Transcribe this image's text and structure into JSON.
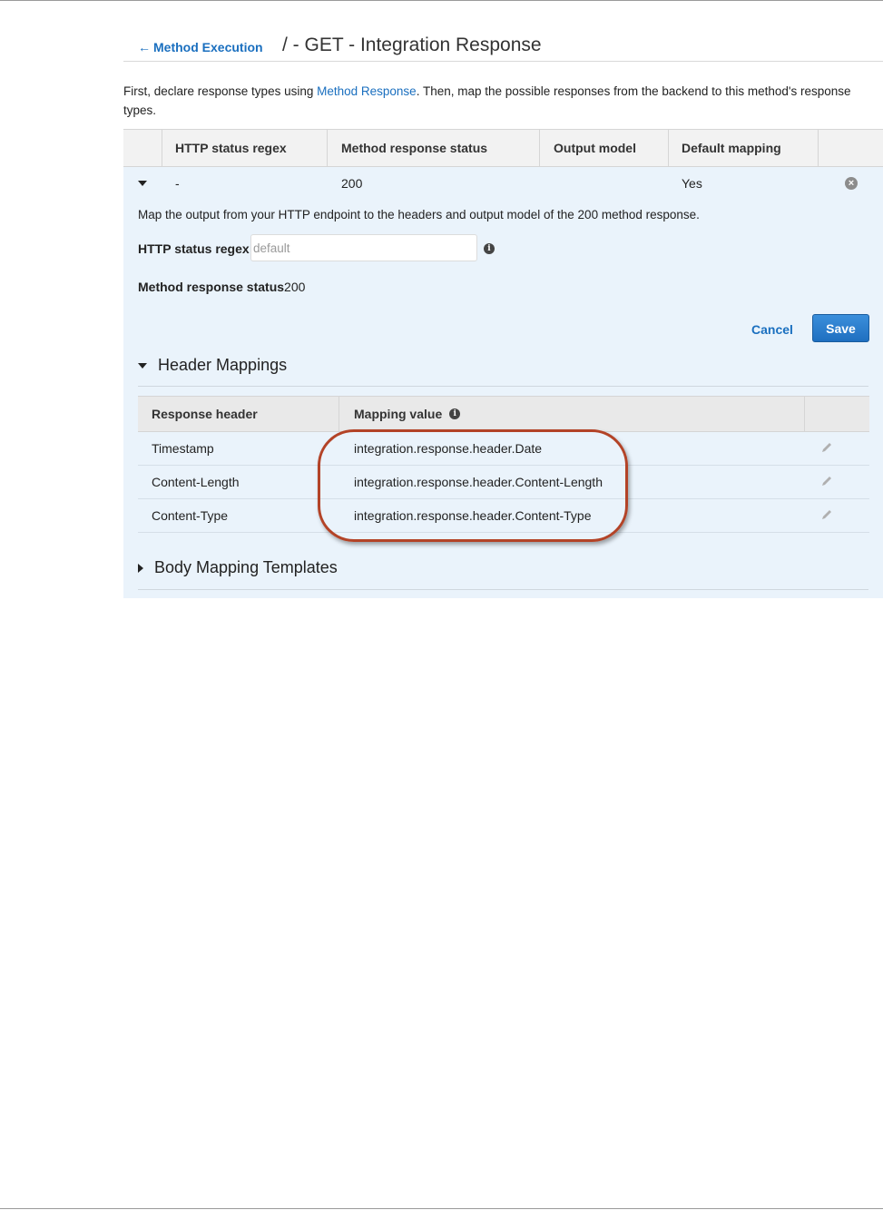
{
  "header": {
    "back_label": "Method Execution",
    "title": "/ - GET - Integration Response"
  },
  "intro": {
    "text_before": "First, declare response types using ",
    "link": "Method Response",
    "text_after": ". Then, map the possible responses from the backend to this method's response types."
  },
  "response_table": {
    "columns": [
      "HTTP status regex",
      "Method response status",
      "Output model",
      "Default mapping"
    ],
    "row": {
      "regex": "-",
      "status": "200",
      "output_model": "",
      "default_mapping": "Yes"
    }
  },
  "panel": {
    "description": "Map the output from your HTTP endpoint to the headers and output model of the 200 method response.",
    "regex_label": "HTTP status regex",
    "regex_placeholder": "default",
    "status_label": "Method response status",
    "status_value": "200",
    "cancel_label": "Cancel",
    "save_label": "Save"
  },
  "header_mappings": {
    "title": "Header Mappings",
    "columns": [
      "Response header",
      "Mapping value"
    ],
    "rows": [
      {
        "header": "Timestamp",
        "value": "integration.response.header.Date"
      },
      {
        "header": "Content-Length",
        "value": "integration.response.header.Content-Length"
      },
      {
        "header": "Content-Type",
        "value": "integration.response.header.Content-Type"
      }
    ]
  },
  "body_mapping": {
    "title": "Body Mapping Templates"
  },
  "icons": {
    "back": "arrow-left-icon",
    "expand": "caret-down-icon",
    "remove": "remove-circle-icon",
    "info": "info-icon",
    "edit": "pencil-icon",
    "collapsed": "caret-right-icon"
  },
  "colors": {
    "link": "#1a6fbf",
    "panel_background": "#eaf3fb",
    "save_button": "#2a7fcf",
    "highlight_annotation": "#b34327"
  }
}
